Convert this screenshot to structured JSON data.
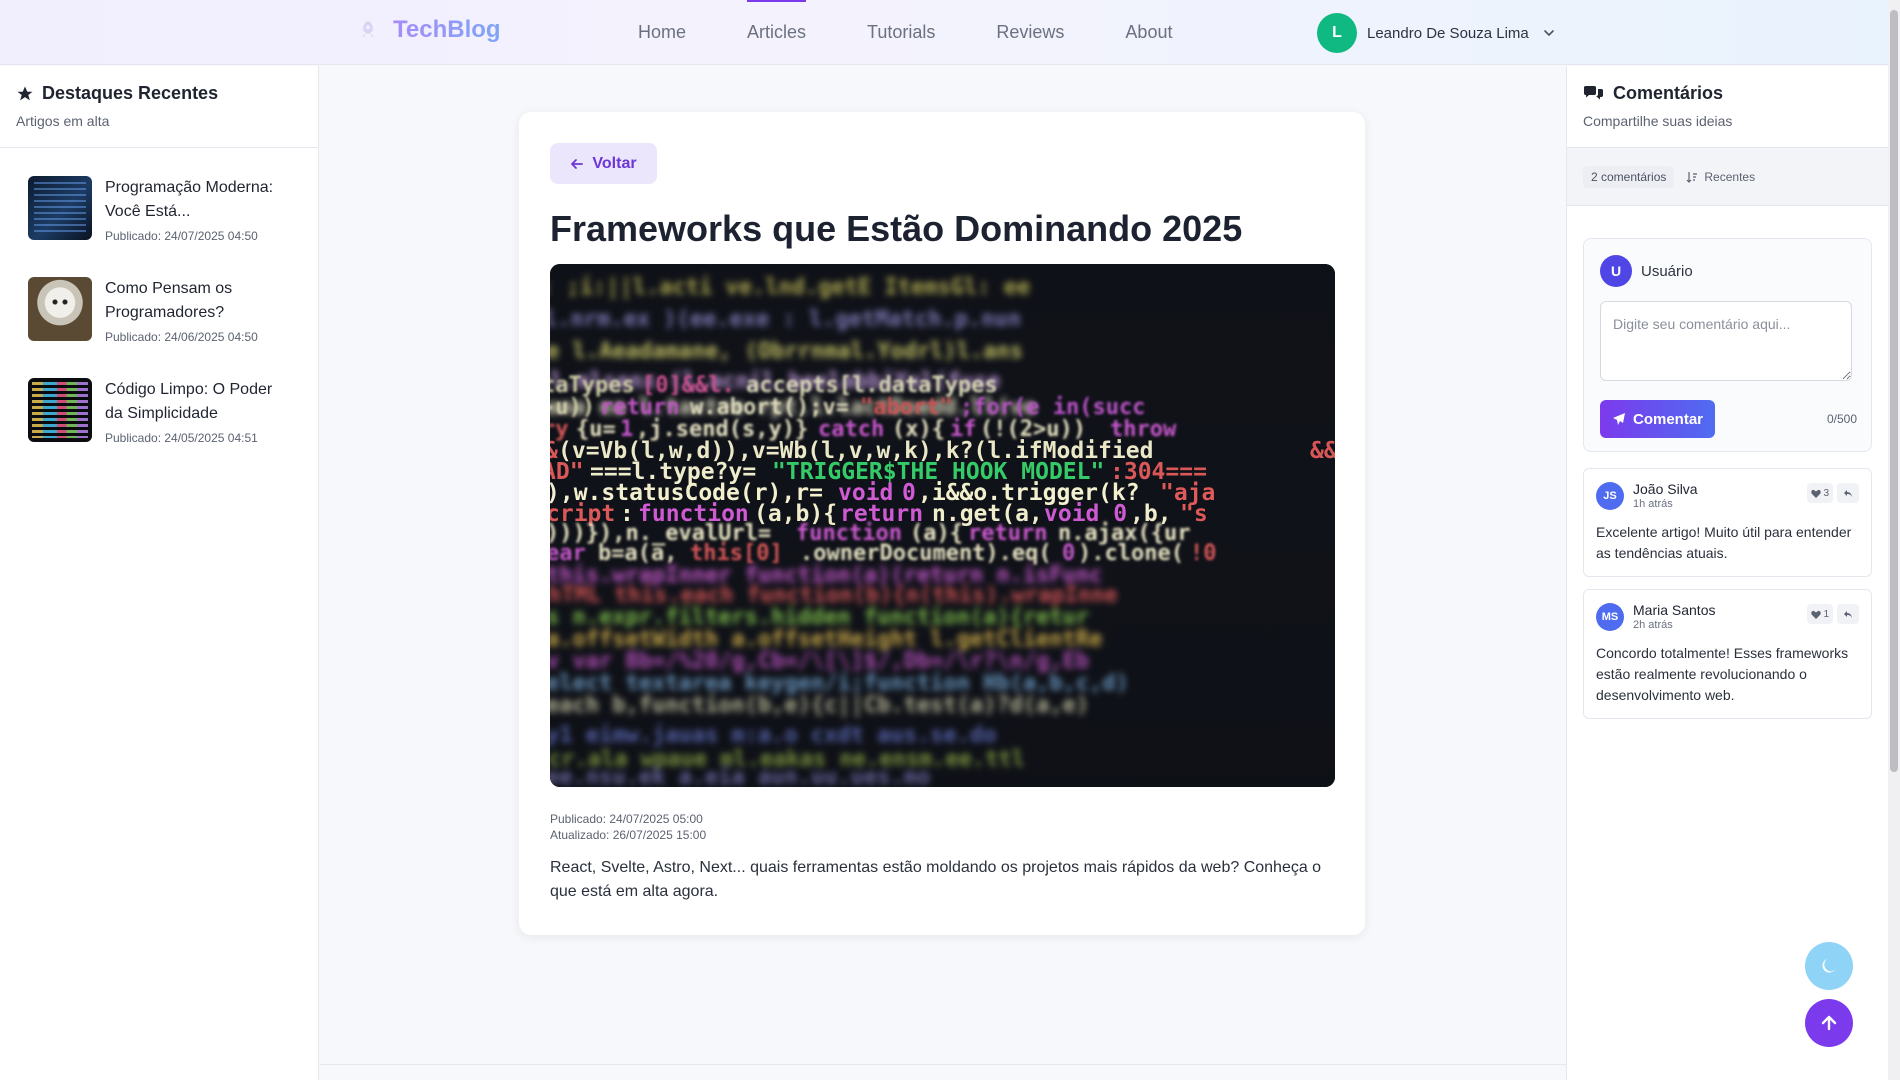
{
  "header": {
    "brand": "TechBlog",
    "nav": [
      "Home",
      "Articles",
      "Tutorials",
      "Reviews",
      "About"
    ],
    "user_initial": "L",
    "user_name": "Leandro De Souza Lima"
  },
  "left_sidebar": {
    "title": "Destaques Recentes",
    "subtitle": "Artigos em alta",
    "items": [
      {
        "title": "Programação Moderna: Você Está...",
        "date": "Publicado: 24/07/2025 04:50"
      },
      {
        "title": "Como Pensam os Programadores?",
        "date": "Publicado: 24/06/2025 04:50"
      },
      {
        "title": "Código Limpo: O Poder da Simplicidade",
        "date": "Publicado: 24/05/2025 04:51"
      }
    ]
  },
  "article": {
    "back_label": "Voltar",
    "title": "Frameworks que Estão Dominando 2025",
    "published": "Publicado: 24/07/2025 05:00",
    "updated": "Atualizado: 26/07/2025 15:00",
    "summary": "React, Svelte, Astro, Next... quais ferramentas estão moldando os projetos mais rápidos da web? Conheça o que está em alta agora."
  },
  "comments_panel": {
    "title": "Comentários",
    "subtitle": "Compartilhe suas ideias",
    "count_label": "2 comentários",
    "sort_label": "Recentes",
    "form": {
      "user_initial": "U",
      "user_name": "Usuário",
      "placeholder": "Digite seu comentário aqui...",
      "submit_label": "Comentar",
      "char_count": "0/500"
    },
    "comments": [
      {
        "initials": "JS",
        "name": "João Silva",
        "time": "1h atrás",
        "likes": "3",
        "text": "Excelente artigo! Muito útil para entender as tendências atuais."
      },
      {
        "initials": "MS",
        "name": "Maria Santos",
        "time": "2h atrás",
        "likes": "1",
        "text": "Concordo totalmente! Esses frameworks estão realmente revolucionando o desenvolvimento web."
      }
    ]
  },
  "colors": {
    "accent": "#7c3aed",
    "brand_gradient_start": "#a78bfa",
    "brand_gradient_end": "#7ea6f5",
    "user_avatar": "#10b981",
    "theme_button": "#8fd3f6"
  },
  "icons": {
    "brand": "rocket-icon",
    "star": "star-icon",
    "comments": "comments-icon",
    "back": "arrow-left-icon",
    "send": "paper-plane-icon",
    "like": "heart-icon",
    "reply": "reply-icon",
    "sort": "sort-icon",
    "theme": "moon-icon",
    "scroll_top": "arrow-up-icon"
  }
}
